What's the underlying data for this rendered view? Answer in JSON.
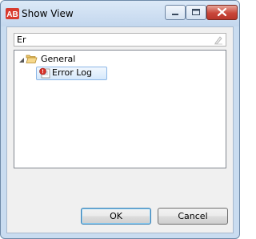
{
  "window": {
    "title": "Show View",
    "app_icon": "eclipse-rcp-logo",
    "controls": [
      "minimize-icon",
      "maximize-icon",
      "close-icon"
    ]
  },
  "filter": {
    "value": "Er",
    "clear_icon": "clear-filter-icon"
  },
  "tree": {
    "items": [
      {
        "label": "General",
        "icon": "folder-open-icon",
        "expanded": true,
        "children": [
          {
            "label": "Error Log",
            "icon": "error-log-icon",
            "selected": true
          }
        ]
      }
    ]
  },
  "buttons": {
    "ok_label": "OK",
    "cancel_label": "Cancel"
  },
  "colors": {
    "titlebar": "#c3d7ee",
    "close_button": "#c9473a",
    "selection": "#d5e8fb",
    "dialog_background": "#f0f0f0"
  }
}
